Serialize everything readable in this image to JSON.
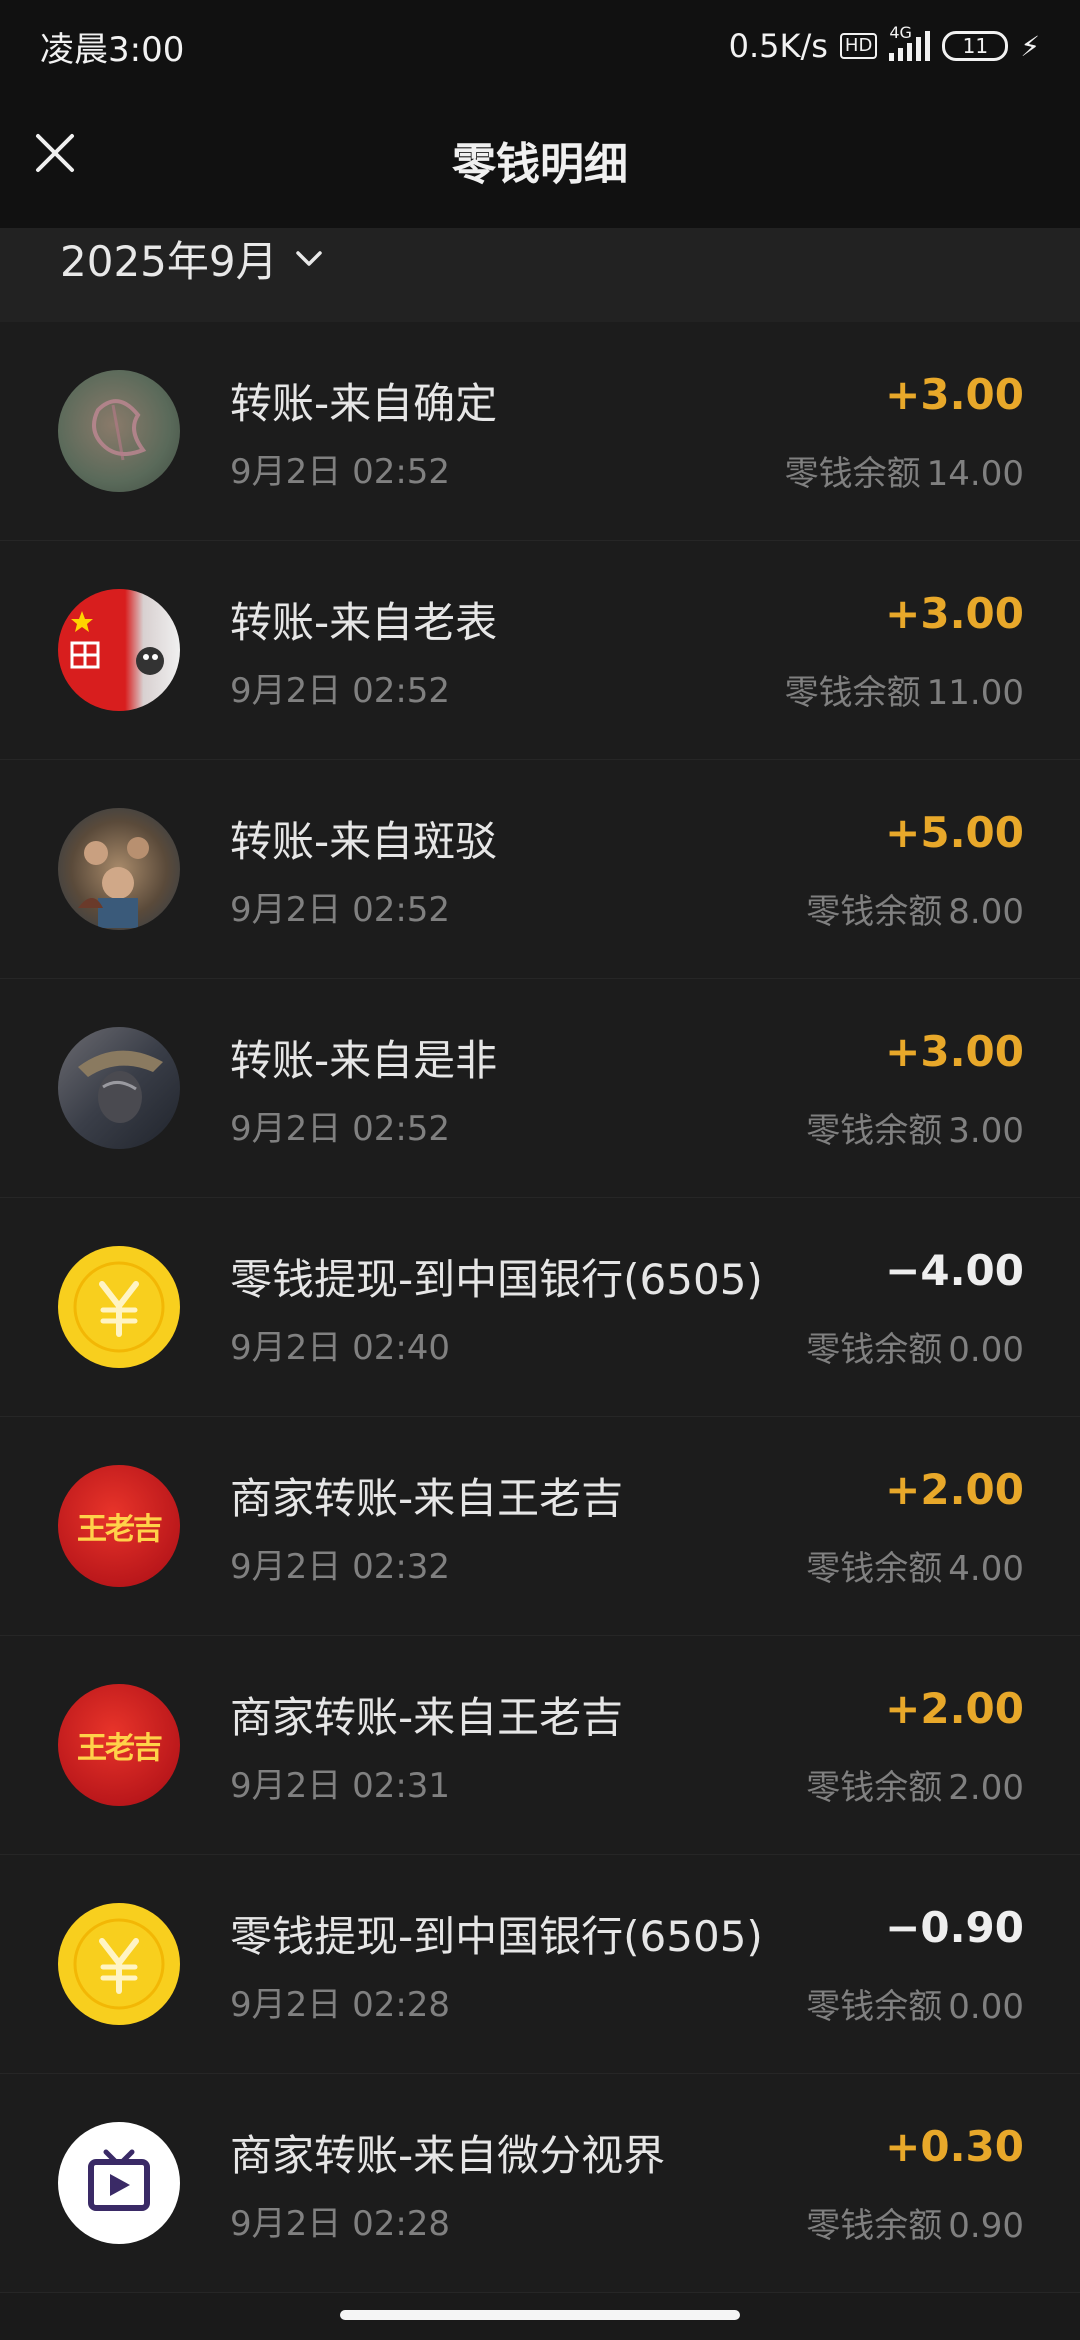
{
  "status_bar": {
    "time": "凌晨3:00",
    "net_speed": "0.5K/s",
    "hd": "HD",
    "network": "4G",
    "battery": "11"
  },
  "header": {
    "title": "零钱明细"
  },
  "filter": {
    "month": "2025年9月"
  },
  "transactions": [
    {
      "title": "转账-来自确定",
      "time": "9月2日 02:52",
      "amount": "+3.00",
      "balance_label": "零钱余额",
      "balance": "14.00",
      "avatar": "photo-flower"
    },
    {
      "title": "转账-来自老表",
      "time": "9月2日 02:52",
      "amount": "+3.00",
      "balance_label": "零钱余额",
      "balance": "11.00",
      "avatar": "photo-flag"
    },
    {
      "title": "转账-来自斑驳",
      "time": "9月2日 02:52",
      "amount": "+5.00",
      "balance_label": "零钱余额",
      "balance": "8.00",
      "avatar": "photo-group"
    },
    {
      "title": "转账-来自是非",
      "time": "9月2日 02:52",
      "amount": "+3.00",
      "balance_label": "零钱余额",
      "balance": "3.00",
      "avatar": "photo-portrait"
    },
    {
      "title": "零钱提现-到中国银行(6505)",
      "time": "9月2日 02:40",
      "amount": "−4.00",
      "balance_label": "零钱余额",
      "balance": "0.00",
      "avatar": "yuan-coin-icon"
    },
    {
      "title": "商家转账-来自王老吉",
      "time": "9月2日 02:32",
      "amount": "+2.00",
      "balance_label": "零钱余额",
      "balance": "4.00",
      "avatar": "wanglaoji-logo",
      "logo_text": "王老吉"
    },
    {
      "title": "商家转账-来自王老吉",
      "time": "9月2日 02:31",
      "amount": "+2.00",
      "balance_label": "零钱余额",
      "balance": "2.00",
      "avatar": "wanglaoji-logo",
      "logo_text": "王老吉"
    },
    {
      "title": "零钱提现-到中国银行(6505)",
      "time": "9月2日 02:28",
      "amount": "−0.90",
      "balance_label": "零钱余额",
      "balance": "0.00",
      "avatar": "yuan-coin-icon"
    },
    {
      "title": "商家转账-来自微分视界",
      "time": "9月2日 02:28",
      "amount": "+0.30",
      "balance_label": "零钱余额",
      "balance": "0.90",
      "avatar": "tv-icon"
    }
  ],
  "colors": {
    "positive": "#e8a82a",
    "negative": "#eeeeee",
    "background": "#1a1a1a"
  }
}
